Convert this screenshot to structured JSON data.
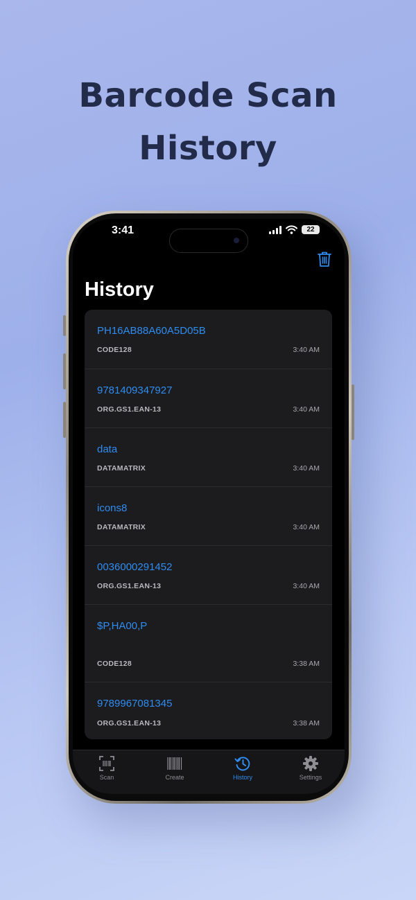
{
  "headline": {
    "line1": "Barcode Scan",
    "line2": "History"
  },
  "status_bar": {
    "time": "3:41",
    "battery": "22"
  },
  "header": {
    "title": "History"
  },
  "history": [
    {
      "value": "PH16AB88A60A5D05B",
      "type": "CODE128",
      "time": "3:40 AM"
    },
    {
      "value": "9781409347927",
      "type": "ORG.GS1.EAN-13",
      "time": "3:40 AM"
    },
    {
      "value": "data",
      "type": "DATAMATRIX",
      "time": "3:40 AM"
    },
    {
      "value": "icons8",
      "type": "DATAMATRIX",
      "time": "3:40 AM"
    },
    {
      "value": "0036000291452",
      "type": "ORG.GS1.EAN-13",
      "time": "3:40 AM"
    },
    {
      "value": "$P,HA00,P",
      "type": "CODE128",
      "time": "3:38 AM"
    },
    {
      "value": "9789967081345",
      "type": "ORG.GS1.EAN-13",
      "time": "3:38 AM"
    }
  ],
  "tabs": [
    {
      "label": "Scan",
      "icon": "scan-icon"
    },
    {
      "label": "Create",
      "icon": "barcode-icon"
    },
    {
      "label": "History",
      "icon": "history-icon",
      "active": true
    },
    {
      "label": "Settings",
      "icon": "gear-icon"
    }
  ],
  "colors": {
    "accent": "#2f8cf0",
    "list_bg": "#1c1c1e",
    "title_text": "#222c4a"
  }
}
